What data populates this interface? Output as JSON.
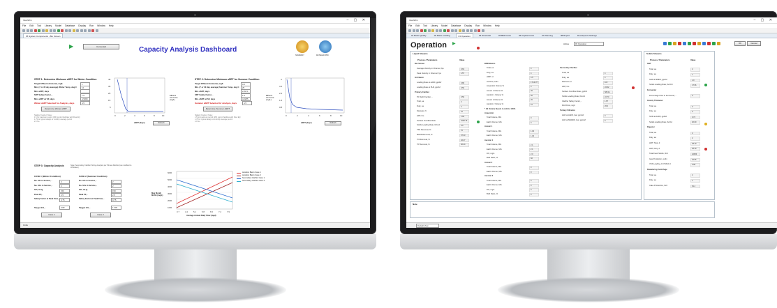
{
  "left_window": {
    "title": "IntesWim",
    "menu": [
      "File",
      "Edit",
      "Tool",
      "Library",
      "Model",
      "Database",
      "Display",
      "Run",
      "Window",
      "Help"
    ],
    "tab": "05 System Components - Bio Screen",
    "converted_label": "Converted",
    "dashboard_title": "Capacity Analysis Dashboard",
    "icon_summary": "SUMMARY",
    "icon_detailed": "DETAILED PFD",
    "step1": {
      "title": "STEP 1: Determine Minimum aSRT for Winter Condition",
      "rows": [
        {
          "label": "Target Effluent Ammonia, mg/L",
          "value": "1"
        },
        {
          "label": "Min. (7 or 30 day average) Winter Temp, deg C",
          "value": "12"
        },
        {
          "label": "Min. aSRT, days",
          "value": ""
        },
        {
          "label": "SRT Safety Factor, -",
          "value": "1.5"
        },
        {
          "label": "Min. aSRT w/ SF, days",
          "value": "4.5360"
        }
      ],
      "note_red": "Winter aSRT Selected for Analysis, days",
      "note_red_value": "4.5",
      "button": "Determine Winter aSRT",
      "legend": "Effluent\nAmmonia\n(mg/L)",
      "xaxis": "aSRT (days)",
      "refresh": "Refresh",
      "safety_title": "Safety Factor Note:",
      "safety_lines": [
        "1.5 for maximum permit (MF) control facilities with Flow EQ",
        "1.75 for typical design or monthly average permit",
        "2.0 No"
      ]
    },
    "step2": {
      "title": "STEP 2: Determine Minimum aSRT for Summer Condition",
      "rows": [
        {
          "label": "Target Effluent Ammonia, mg/L",
          "value": "0.5"
        },
        {
          "label": "Min. (7 or 30 day average) Summer Temp, deg C",
          "value": "25"
        },
        {
          "label": "Min. aSRT, days",
          "value": "2.8171"
        },
        {
          "label": "SRT Safety Factor, -",
          "value": "1.5"
        },
        {
          "label": "Min. aSRT w/ SF, days",
          "value": "4.2255"
        }
      ],
      "note_red": "Summer aSRT Selected for Analysis, days",
      "note_red_value": "4.5",
      "button": "Determine Summer aSRT",
      "legend": "Effluent\nAmmonia\n(mg/L)",
      "xaxis": "aSRT (days)",
      "refresh": "Refresh",
      "safety_title": "Safety Factor Note:",
      "safety_lines": [
        "1.5 for maximum permit (MF) control facilities with Flow EQ",
        "1.75 for typical design or monthly average permit",
        "2.0 No"
      ]
    },
    "step3": {
      "title": "STEP 3: Capacity Analysis",
      "subtitle": "Note: Secondary Clarifier Sizing Analysis per Pitman Method (as modified to Whittaker)",
      "case1_title": "CASE 1 (Winter Condition)",
      "case2_title": "CASE 2 (Summer Condition)",
      "case_rows": [
        "No. ATs in Service, -",
        "No. SCs in Service, -",
        "SVI, mL/g",
        "Peak PF, -",
        "Safety Factor at Peak Flow, -"
      ],
      "case1_values": [
        "2",
        "2",
        "150",
        "2.5",
        "0.75"
      ],
      "case2_values": [
        "2",
        "2",
        "150",
        "2.5",
        "0.75"
      ],
      "target_label": "Target CV, -",
      "target1": "0.89",
      "target2": "1.000",
      "case1_btn": "Case 1",
      "case2_btn": "Case 2",
      "chart_ylabel": "Max Month\nMLSS (mg/L)",
      "chart_xlabel": "Average Annual Daily Flow (mgd)",
      "legend": [
        "Aeration Basin Case 1",
        "Aeration Basin Case 2",
        "Secondary Clarifier Case 1",
        "Secondary Clarifier Case 2"
      ],
      "legend_colors": [
        "#e03030",
        "#a02020",
        "#3070d0",
        "#30b0d0"
      ]
    },
    "status_left": "Units"
  },
  "right_window": {
    "title": "IntesWim",
    "menu": [
      "File",
      "Edit",
      "Tool",
      "Library",
      "Model",
      "Database",
      "Display",
      "Run",
      "Window",
      "Help"
    ],
    "tabs": [
      "01 Basic Quality",
      "02 Mass Loading",
      "03 Operation",
      "04 Structural",
      "05 BMI Costs",
      "06 Capital Costs",
      "07 Planning",
      "08 Report",
      "Developer/a Settings"
    ],
    "page_title": "Operation",
    "scenario_label": "Active",
    "scenario_value": "03 Operation",
    "ok": "OK",
    "cancel": "Cancel",
    "panel_liquid": "Liquid Streams",
    "panel_solids": "Solids Streams",
    "col_process": "Process / Parameters",
    "col_value": "Value",
    "liquid_left": [
      {
        "label": "Bar Screen",
        "value": ""
      },
      {
        "label": "Average Velocity in Channel, fps",
        "value": "0.63"
      },
      {
        "label": "Peak Velocity in Channel, fps",
        "value": "1.57"
      },
      {
        "label": "Grit Basin",
        "value": ""
      },
      {
        "label": "Loading Rate at AADF, gpd/sf",
        "value": "3.80"
      },
      {
        "label": "Loading Rate at PHF, gpd/sf",
        "value": "9.50"
      },
      {
        "label": "Primary Clarifier",
        "value": ""
      },
      {
        "label": "PC Split Fraction, -",
        "value": "0.50"
      },
      {
        "label": "Total, ea",
        "value": "2"
      },
      {
        "label": "Duty, ea",
        "value": "2"
      },
      {
        "label": "Diameter, ft",
        "value": "70"
      },
      {
        "label": "HRT, hrs",
        "value": "1.94"
      },
      {
        "label": "Surface Overflow Rate",
        "value": "1000.76"
      },
      {
        "label": "Solids Loading Rate, lb/sf-d",
        "value": "6.5"
      },
      {
        "label": "TSS Removal, %",
        "value": "70"
      },
      {
        "label": "BOD5 Removal, %",
        "value": "37.33"
      },
      {
        "label": "TN Removal, %",
        "value": "22.27"
      },
      {
        "label": "TP Removal, %",
        "value": "40.24"
      }
    ],
    "liquid_mid": [
      {
        "label": "BNR Basins",
        "value": ""
      },
      {
        "label": "Total, ea",
        "value": "4"
      },
      {
        "label": "Duty, ea",
        "value": "4"
      },
      {
        "label": "aSRT, d",
        "value": "4.5"
      },
      {
        "label": "Air Flow, scfm",
        "value": "17140.77"
      },
      {
        "label": "Anaerobic Volume %",
        "value": "0"
      },
      {
        "label": "Anoxic 1 Volume %",
        "value": "20"
      },
      {
        "label": "Aerobic 1 Volume %",
        "value": "50"
      },
      {
        "label": "Anoxic 2 Volume %",
        "value": "20"
      },
      {
        "label": "Aerobic 2 Volume %",
        "value": "10"
      },
      {
        "label": "* All Volume Needs to Add to 100%",
        "value": ""
      },
      {
        "label": "Anaerobic",
        "value": ""
      },
      {
        "label": "Total Volume, MG",
        "value": "0"
      },
      {
        "label": "Each Volume, MG",
        "value": "0"
      },
      {
        "label": "Anoxic 1",
        "value": ""
      },
      {
        "label": "Total Volume, MG",
        "value": "1.04"
      },
      {
        "label": "Each Volume, MG",
        "value": "1.04"
      },
      {
        "label": "Aerobic 1",
        "value": ""
      },
      {
        "label": "Total Volume, MG",
        "value": "2.1"
      },
      {
        "label": "Each Volume, MG",
        "value": "2.1"
      },
      {
        "label": "DO, mg/L",
        "value": "2.0"
      },
      {
        "label": "BLR Ratio, %",
        "value": "60"
      },
      {
        "label": "Anoxic 2",
        "value": ""
      },
      {
        "label": "Total Volume, MG",
        "value": "0"
      },
      {
        "label": "Each Volume, MG",
        "value": "0"
      },
      {
        "label": "Aerobic 2",
        "value": ""
      },
      {
        "label": "Total Volume, MG",
        "value": "0"
      },
      {
        "label": "Each Volume, MG",
        "value": "0"
      },
      {
        "label": "DO, mg/L",
        "value": "0"
      },
      {
        "label": "BLR Ratio, %",
        "value": "0"
      }
    ],
    "liquid_right": [
      {
        "label": "Secondary Clarifier",
        "value": ""
      },
      {
        "label": "Total, ea",
        "value": "4"
      },
      {
        "label": "Duty, ea",
        "value": "4"
      },
      {
        "label": "Diameter, ft",
        "value": "115"
      },
      {
        "label": "HRT, hrs",
        "value": "22.62"
      },
      {
        "label": "Surface Overflow Rate, gpd/sf",
        "value": "580.11"
      },
      {
        "label": "Solids Loading Rate, lb/sf-d",
        "value": "22.70"
      },
      {
        "label": "Clarifier Safety Factor, -",
        "value": "1.67"
      },
      {
        "label": "RAS Flow, mgd",
        "value": "26.0"
      },
      {
        "label": "Tertiary Filtration",
        "value": ""
      },
      {
        "label": "HLR at AADF, Gal, gpm/sf",
        "value": "0"
      },
      {
        "label": "HLR at MMADF, Gal, gpm/sf",
        "value": "0"
      }
    ],
    "solids": [
      {
        "label": "GBT",
        "value": ""
      },
      {
        "label": "Total, ea",
        "value": "2"
      },
      {
        "label": "Duty, ea",
        "value": "1"
      },
      {
        "label": "SLR at MMDF, gpd/sf",
        "value": "1.0"
      },
      {
        "label": "Solids Loading Rate, lb/sf-hr",
        "value": "17.96"
      },
      {
        "label": "Fermenter",
        "value": ""
      },
      {
        "label": "Percentage Flow to Fermenter, -",
        "value": "0"
      },
      {
        "label": "Gravity Thickener",
        "value": ""
      },
      {
        "label": "Total, ea",
        "value": "0"
      },
      {
        "label": "Duty, ea",
        "value": "0"
      },
      {
        "label": "SOR at AADF, gpd/sf",
        "value": "0.74"
      },
      {
        "label": "Solids Loading Rate, lb/sf-d",
        "value": "20.09"
      },
      {
        "label": "Digester",
        "value": ""
      },
      {
        "label": "Total, ea",
        "value": "2"
      },
      {
        "label": "Duty, ea",
        "value": "2"
      },
      {
        "label": "HRT, Total, d",
        "value": "18.19"
      },
      {
        "label": "HRT, Duty, d",
        "value": "18.19"
      },
      {
        "label": "Total Feed Solids, lb/d",
        "value": "42353"
      },
      {
        "label": "Gas Production, scfm",
        "value": "42.05"
      },
      {
        "label": "VSS Loading, lb VSS/cf-d",
        "value": "0.08"
      },
      {
        "label": "Dewatering Centrifuge",
        "value": ""
      },
      {
        "label": "Total, ea",
        "value": "2"
      },
      {
        "label": "Duty, ea",
        "value": "1"
      },
      {
        "label": "Cake Production, lb/d",
        "value": "61.4"
      }
    ],
    "note_label": "Note",
    "status": "Default View"
  }
}
